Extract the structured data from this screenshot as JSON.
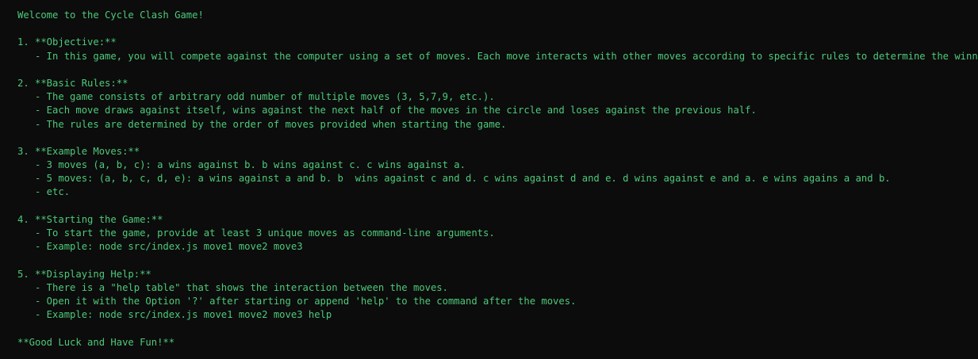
{
  "welcome": "Welcome to the Cycle Clash Game!",
  "sections": [
    {
      "title": "1. **Objective:**",
      "items": [
        "   - In this game, you will compete against the computer using a set of moves. Each move interacts with other moves according to specific rules to determine the winner."
      ]
    },
    {
      "title": "2. **Basic Rules:**",
      "items": [
        "   - The game consists of arbitrary odd number of multiple moves (3, 5,7,9, etc.).",
        "   - Each move draws against itself, wins against the next half of the moves in the circle and loses against the previous half.",
        "   - The rules are determined by the order of moves provided when starting the game."
      ]
    },
    {
      "title": "3. **Example Moves:**",
      "items": [
        "   - 3 moves (a, b, c): a wins against b. b wins against c. c wins against a.",
        "   - 5 moves: (a, b, c, d, e): a wins against a and b. b  wins against c and d. c wins against d and e. d wins against e and a. e wins agains a and b.",
        "   - etc."
      ]
    },
    {
      "title": "4. **Starting the Game:**",
      "items": [
        "   - To start the game, provide at least 3 unique moves as command-line arguments.",
        "   - Example: node src/index.js move1 move2 move3"
      ]
    },
    {
      "title": "5. **Displaying Help:**",
      "items": [
        "   - There is a \"help table\" that shows the interaction between the moves.",
        "   - Open it with the Option '?' after starting or append 'help' to the command after the moves.",
        "   - Example: node src/index.js move1 move2 move3 help"
      ]
    }
  ],
  "closing": "**Good Luck and Have Fun!**",
  "colors": {
    "background": "#0c0c0c",
    "text": "#4ec97a"
  }
}
